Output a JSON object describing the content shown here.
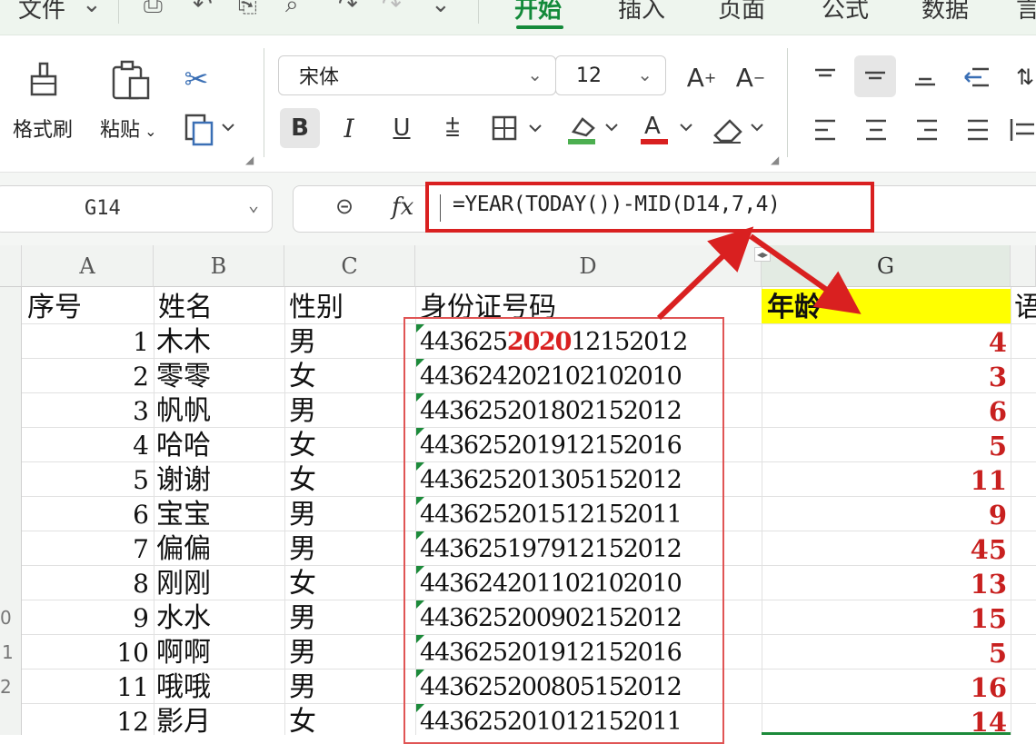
{
  "tabs": {
    "file": "文件",
    "home": "开始",
    "insert": "插入",
    "page": "页面",
    "formula": "公式",
    "data": "数据",
    "partial_next": "言"
  },
  "ribbon": {
    "format_painter": "格式刷",
    "paste": "粘贴",
    "font_name": "宋体",
    "font_size": "12",
    "bold": "B",
    "italic": "I",
    "underline": "U"
  },
  "formula_bar": {
    "name_box": "G14",
    "fx": "fx",
    "formula": "=YEAR(TODAY())-MID(D14,7,4)"
  },
  "grid": {
    "columns": [
      "A",
      "B",
      "C",
      "D",
      "G"
    ],
    "headers": {
      "a": "序号",
      "b": "姓名",
      "c": "性别",
      "d": "身份证号码",
      "g": "年龄",
      "next": "语"
    },
    "rows": [
      {
        "no": "1",
        "name": "木木",
        "sex": "男",
        "id_pre": "443625",
        "id_hi": "2020",
        "id_post": "12152012",
        "age": "4"
      },
      {
        "no": "2",
        "name": "零零",
        "sex": "女",
        "id": "443624202102102010",
        "age": "3"
      },
      {
        "no": "3",
        "name": "帆帆",
        "sex": "男",
        "id": "443625201802152012",
        "age": "6"
      },
      {
        "no": "4",
        "name": "哈哈",
        "sex": "女",
        "id": "443625201912152016",
        "age": "5"
      },
      {
        "no": "5",
        "name": "谢谢",
        "sex": "女",
        "id": "443625201305152012",
        "age": "11"
      },
      {
        "no": "6",
        "name": "宝宝",
        "sex": "男",
        "id": "443625201512152011",
        "age": "9"
      },
      {
        "no": "7",
        "name": "偏偏",
        "sex": "男",
        "id": "443625197912152012",
        "age": "45"
      },
      {
        "no": "8",
        "name": "刚刚",
        "sex": "女",
        "id": "443624201102102010",
        "age": "13"
      },
      {
        "no": "9",
        "name": "水水",
        "sex": "男",
        "id": "443625200902152012",
        "age": "15"
      },
      {
        "no": "10",
        "name": "啊啊",
        "sex": "男",
        "id": "443625201912152016",
        "age": "5"
      },
      {
        "no": "11",
        "name": "哦哦",
        "sex": "男",
        "id": "443625200805152012",
        "age": "16"
      },
      {
        "no": "12",
        "name": "影月",
        "sex": "女",
        "id": "443625201012152011",
        "age": "14"
      }
    ],
    "row_numbers": [
      "0",
      "1",
      "2"
    ]
  },
  "colors": {
    "accent_green": "#138a3a",
    "highlight_red": "#d92020",
    "header_yellow": "#ffff00",
    "age_red": "#c8201f"
  }
}
